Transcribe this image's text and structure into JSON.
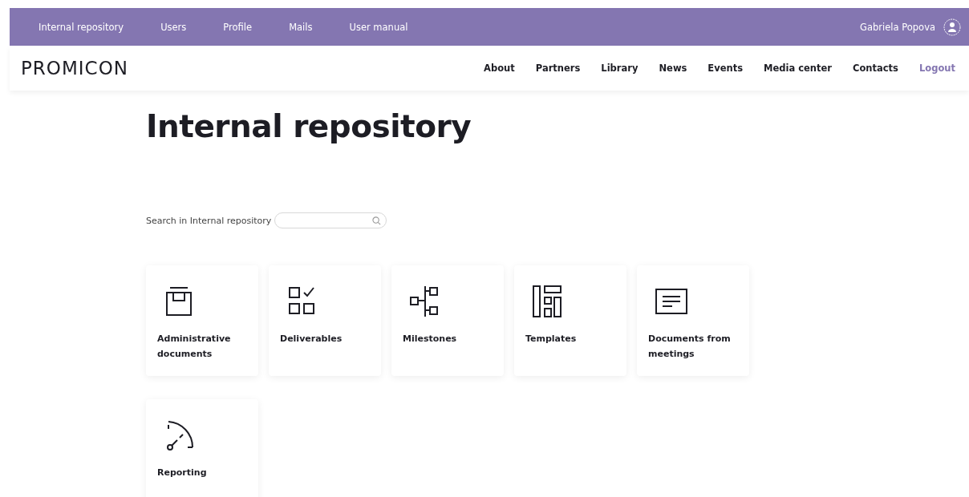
{
  "top_bar": {
    "links": [
      {
        "label": "Internal repository"
      },
      {
        "label": "Users"
      },
      {
        "label": "Profile"
      },
      {
        "label": "Mails"
      },
      {
        "label": "User manual"
      }
    ],
    "user": "Gabriela Popova"
  },
  "header": {
    "logo": "PROMICON",
    "nav": [
      {
        "label": "About",
        "kind": "link"
      },
      {
        "label": "Partners",
        "kind": "link"
      },
      {
        "label": "Library",
        "kind": "link"
      },
      {
        "label": "News",
        "kind": "link"
      },
      {
        "label": "Events",
        "kind": "link"
      },
      {
        "label": "Media center",
        "kind": "link"
      },
      {
        "label": "Contacts",
        "kind": "link"
      },
      {
        "label": "Logout",
        "kind": "logout"
      }
    ]
  },
  "page_title": "Internal repository",
  "search": {
    "label": "Search in Internal repository"
  },
  "categories": [
    {
      "label": "Administrative documents",
      "kind": "archive"
    },
    {
      "label": "Deliverables",
      "kind": "checklist"
    },
    {
      "label": "Milestones",
      "kind": "milestones"
    },
    {
      "label": "Templates",
      "kind": "templates"
    },
    {
      "label": "Documents from meetings",
      "kind": "document"
    },
    {
      "label": "Reporting",
      "kind": "gauge"
    }
  ]
}
